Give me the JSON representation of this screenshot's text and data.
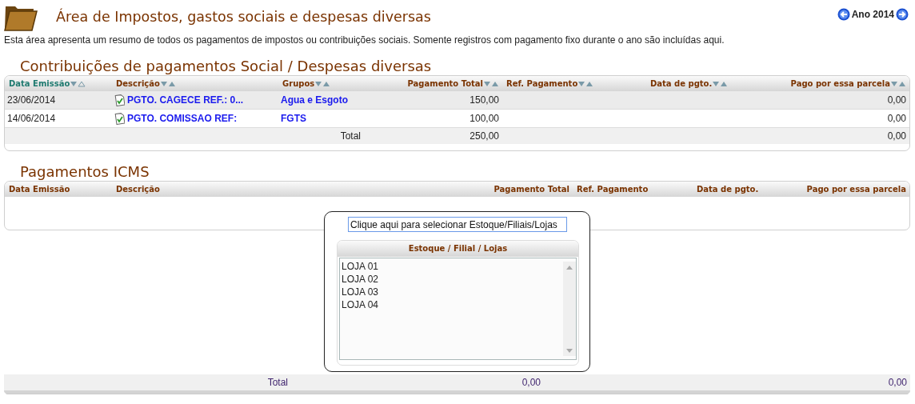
{
  "page": {
    "title": "Área de Impostos, gastos sociais e despesas diversas",
    "year": "Ano 2014",
    "description": "Esta área apresenta um resumo de todos os pagamentos de impostos ou contribuições sociais. Somente registros com pagamento fixo durante o ano são incluídas aqui."
  },
  "contribuicoes": {
    "heading": "Contribuições de pagamentos Social / Despesas diversas",
    "columns": [
      {
        "label": "Data Emissão",
        "sorted": true
      },
      {
        "label": "Descrição",
        "sorted": false
      },
      {
        "label": "Grupos",
        "sorted": false
      },
      {
        "label": "Pagamento Total",
        "sorted": false
      },
      {
        "label": "Ref. Pagamento",
        "sorted": false
      },
      {
        "label": "Data de pgto.",
        "sorted": false
      },
      {
        "label": "Pago por essa parcela",
        "sorted": false
      }
    ],
    "rows": [
      {
        "data_emissao": "23/06/2014",
        "descricao": "PGTO. CAGECE REF.: 0...",
        "grupo": "Agua e Esgoto",
        "pagamento_total": "150,00",
        "pago": "0,00"
      },
      {
        "data_emissao": "14/06/2014",
        "descricao": "PGTO. COMISSAO REF:",
        "grupo": "FGTS",
        "pagamento_total": "100,00",
        "pago": "0,00"
      }
    ],
    "total": {
      "label": "Total",
      "pagamento_total": "250,00",
      "pago": "0,00"
    }
  },
  "icms": {
    "heading": "Pagamentos ICMS",
    "columns": [
      "Data Emissão",
      "Descrição",
      "Pagamento Total",
      "Ref. Pagamento",
      "Data de pgto.",
      "Pago por essa parcela"
    ],
    "total": {
      "label": "Total",
      "pagamento_total": "0,00",
      "pago": "0,00"
    }
  },
  "popup": {
    "field_value": "Clique aqui para selecionar Estoque/Filiais/Lojas",
    "list_heading": "Estoque / Filial / Lojas",
    "items": [
      "LOJA 01",
      "LOJA 02",
      "LOJA 03",
      "LOJA 04"
    ]
  }
}
